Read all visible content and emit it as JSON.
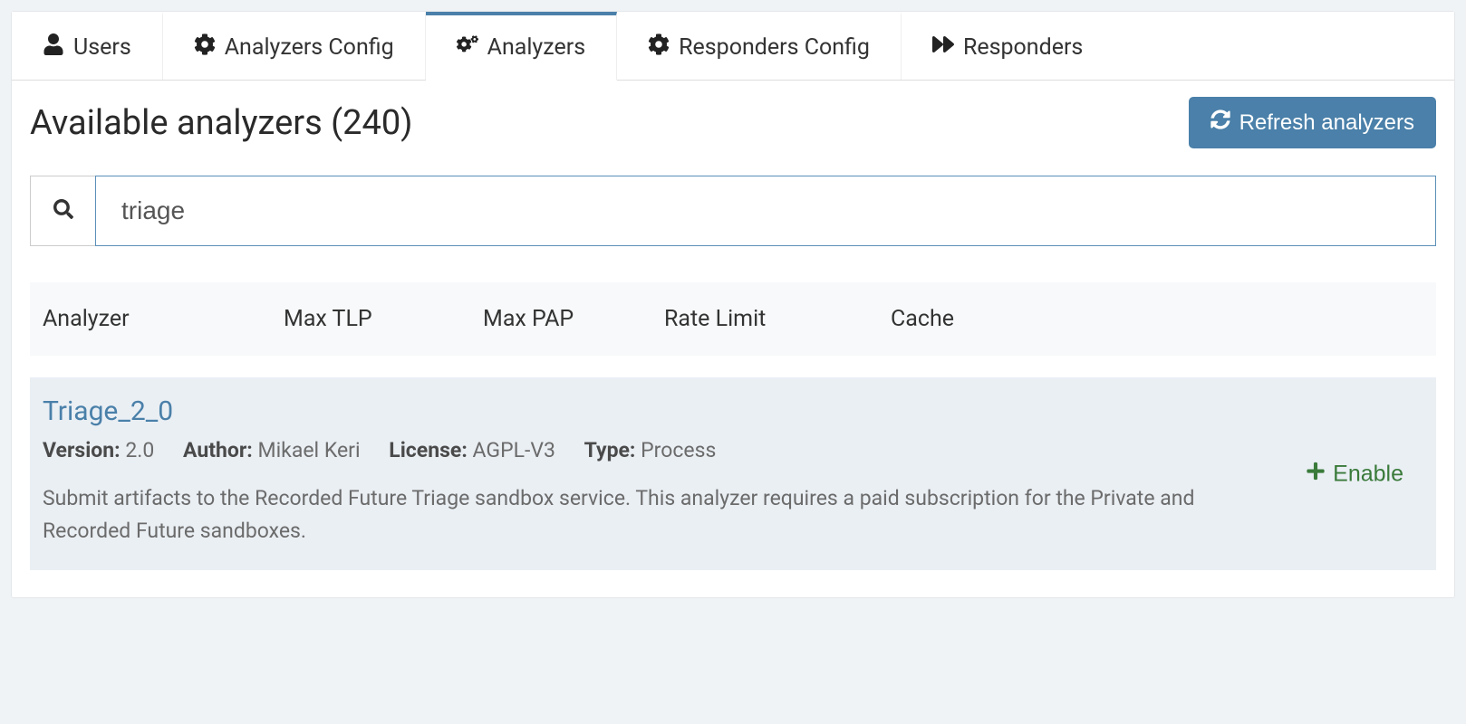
{
  "tabs": {
    "users": "Users",
    "analyzers_config": "Analyzers Config",
    "analyzers": "Analyzers",
    "responders_config": "Responders Config",
    "responders": "Responders"
  },
  "header": {
    "title": "Available analyzers (240)",
    "refresh_label": "Refresh analyzers"
  },
  "search": {
    "value": "triage"
  },
  "columns": {
    "analyzer": "Analyzer",
    "max_tlp": "Max TLP",
    "max_pap": "Max PAP",
    "rate_limit": "Rate Limit",
    "cache": "Cache"
  },
  "result": {
    "name": "Triage_2_0",
    "version_label": "Version:",
    "version_value": "2.0",
    "author_label": "Author:",
    "author_value": "Mikael Keri",
    "license_label": "License:",
    "license_value": "AGPL-V3",
    "type_label": "Type:",
    "type_value": "Process",
    "description": "Submit artifacts to the Recorded Future Triage sandbox service. This analyzer requires a paid subscription for the Private and Recorded Future sandboxes.",
    "enable_label": "Enable"
  }
}
